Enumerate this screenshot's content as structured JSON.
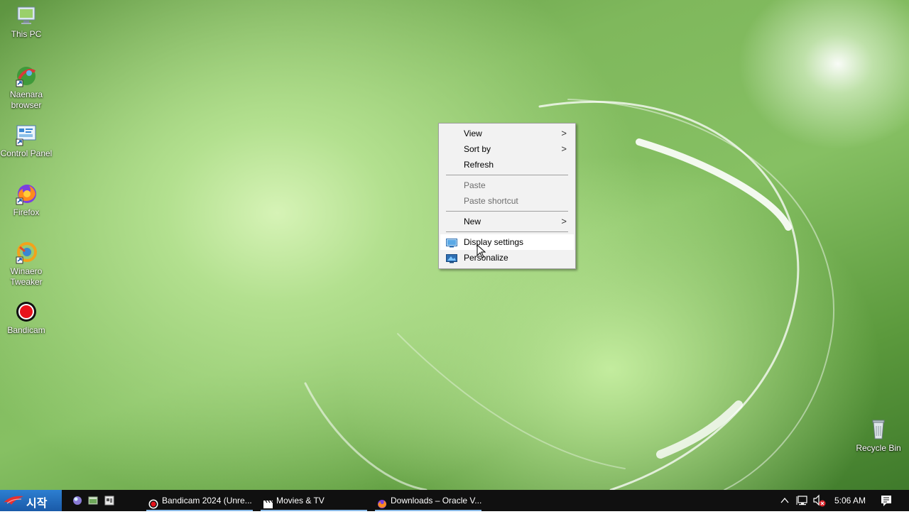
{
  "desktop": {
    "icons": [
      {
        "label": "This PC",
        "icon": "monitor-icon"
      },
      {
        "label": "Naenara browser",
        "icon": "naenara-browser-icon"
      },
      {
        "label": "Control Panel",
        "icon": "control-panel-icon"
      },
      {
        "label": "Firefox",
        "icon": "firefox-icon"
      },
      {
        "label": "Winaero Tweaker",
        "icon": "winaero-tweaker-icon"
      },
      {
        "label": "Bandicam",
        "icon": "bandicam-icon"
      },
      {
        "label": "Recycle Bin",
        "icon": "recycle-bin-icon"
      }
    ]
  },
  "context_menu": {
    "items": [
      {
        "label": "View",
        "submenu": true,
        "enabled": true
      },
      {
        "label": "Sort by",
        "submenu": true,
        "enabled": true
      },
      {
        "label": "Refresh",
        "submenu": false,
        "enabled": true
      },
      {
        "label": "Paste",
        "submenu": false,
        "enabled": false
      },
      {
        "label": "Paste shortcut",
        "submenu": false,
        "enabled": false
      },
      {
        "label": "New",
        "submenu": true,
        "enabled": true
      },
      {
        "label": "Display settings",
        "submenu": false,
        "enabled": true,
        "icon": "display-settings-icon",
        "hovered": true
      },
      {
        "label": "Personalize",
        "submenu": false,
        "enabled": true,
        "icon": "personalize-icon"
      }
    ],
    "submenu_arrow": ">"
  },
  "taskbar": {
    "start_label": "시작",
    "quick_launch": [
      "globe-icon",
      "show-desktop-icon",
      "window-switcher-icon"
    ],
    "tasks": [
      {
        "label": "Bandicam 2024 (Unre...",
        "icon": "bandicam-icon"
      },
      {
        "label": "Movies & TV",
        "icon": "clapperboard-icon"
      },
      {
        "label": "Downloads – Oracle V...",
        "icon": "firefox-icon"
      }
    ],
    "tray": {
      "clock": "5:06 AM",
      "icons": [
        "chevron-up-icon",
        "network-icon",
        "volume-muted-icon",
        "notification-icon"
      ]
    }
  },
  "colors": {
    "accent": "#1a5aa8",
    "taskbar": "#101010",
    "menu_bg": "#f2f2f2"
  }
}
